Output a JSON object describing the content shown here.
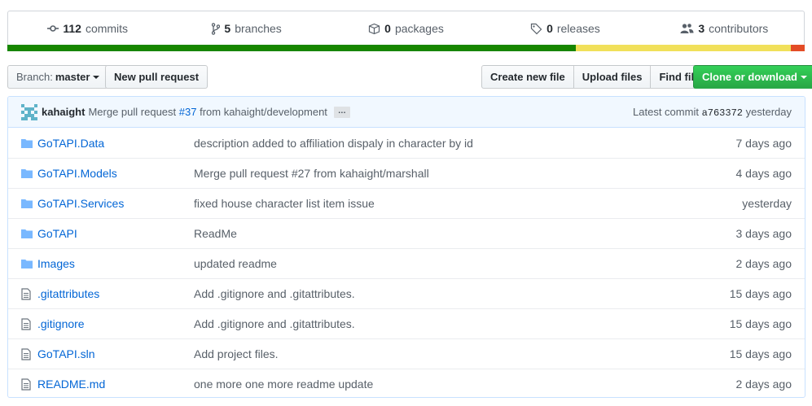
{
  "summary": {
    "commits": {
      "count": "112",
      "label": "commits"
    },
    "branches": {
      "count": "5",
      "label": "branches"
    },
    "packages": {
      "count": "0",
      "label": "packages"
    },
    "releases": {
      "count": "0",
      "label": "releases"
    },
    "contributors": {
      "count": "3",
      "label": "contributors"
    },
    "language_bar": [
      {
        "color": "#178600",
        "percent": 71.3
      },
      {
        "color": "#f1e05a",
        "percent": 27.0
      },
      {
        "color": "#e34c26",
        "percent": 1.7
      }
    ]
  },
  "toolbar": {
    "branch_prefix": "Branch:",
    "branch_name": "master",
    "new_pull_request": "New pull request",
    "create_new_file": "Create new file",
    "upload_files": "Upload files",
    "find_file": "Find file",
    "clone_or_download": "Clone or download"
  },
  "commit_tease": {
    "author": "kahaight",
    "message_prefix": "Merge pull request",
    "pr_number": "#37",
    "message_suffix": "from kahaight/development",
    "ellipsis": "…",
    "latest_label": "Latest commit",
    "sha": "a763372",
    "age": "yesterday"
  },
  "files": [
    {
      "type": "folder",
      "icon": "folder-icon",
      "name": "GoTAPI.Data",
      "message": "description added to affiliation dispaly in character by id",
      "age": "7 days ago"
    },
    {
      "type": "folder",
      "icon": "folder-icon",
      "name": "GoTAPI.Models",
      "message": "Merge pull request #27 from kahaight/marshall",
      "age": "4 days ago"
    },
    {
      "type": "folder",
      "icon": "folder-icon",
      "name": "GoTAPI.Services",
      "message": "fixed house character list item issue",
      "age": "yesterday"
    },
    {
      "type": "folder",
      "icon": "folder-icon",
      "name": "GoTAPI",
      "message": "ReadMe",
      "age": "3 days ago"
    },
    {
      "type": "folder",
      "icon": "folder-icon",
      "name": "Images",
      "message": "updated readme",
      "age": "2 days ago"
    },
    {
      "type": "file",
      "icon": "file-icon",
      "name": ".gitattributes",
      "message": "Add .gitignore and .gitattributes.",
      "age": "15 days ago"
    },
    {
      "type": "file",
      "icon": "file-icon",
      "name": ".gitignore",
      "message": "Add .gitignore and .gitattributes.",
      "age": "15 days ago"
    },
    {
      "type": "file",
      "icon": "file-icon",
      "name": "GoTAPI.sln",
      "message": "Add project files.",
      "age": "15 days ago"
    },
    {
      "type": "file",
      "icon": "file-icon",
      "name": "README.md",
      "message": "one more one more readme update",
      "age": "2 days ago"
    }
  ]
}
